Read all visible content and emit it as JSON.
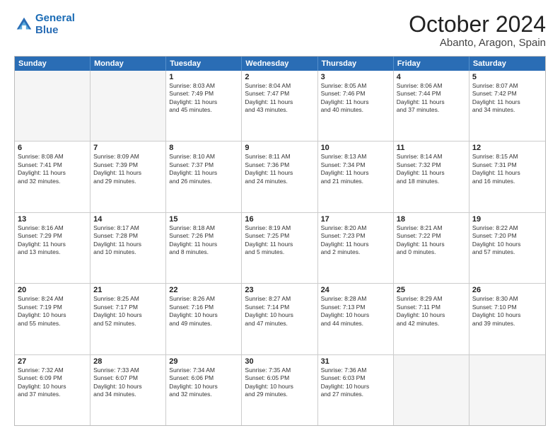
{
  "header": {
    "logo_line1": "General",
    "logo_line2": "Blue",
    "month": "October 2024",
    "location": "Abanto, Aragon, Spain"
  },
  "weekdays": [
    "Sunday",
    "Monday",
    "Tuesday",
    "Wednesday",
    "Thursday",
    "Friday",
    "Saturday"
  ],
  "rows": [
    [
      {
        "day": "",
        "text": ""
      },
      {
        "day": "",
        "text": ""
      },
      {
        "day": "1",
        "text": "Sunrise: 8:03 AM\nSunset: 7:49 PM\nDaylight: 11 hours\nand 45 minutes."
      },
      {
        "day": "2",
        "text": "Sunrise: 8:04 AM\nSunset: 7:47 PM\nDaylight: 11 hours\nand 43 minutes."
      },
      {
        "day": "3",
        "text": "Sunrise: 8:05 AM\nSunset: 7:46 PM\nDaylight: 11 hours\nand 40 minutes."
      },
      {
        "day": "4",
        "text": "Sunrise: 8:06 AM\nSunset: 7:44 PM\nDaylight: 11 hours\nand 37 minutes."
      },
      {
        "day": "5",
        "text": "Sunrise: 8:07 AM\nSunset: 7:42 PM\nDaylight: 11 hours\nand 34 minutes."
      }
    ],
    [
      {
        "day": "6",
        "text": "Sunrise: 8:08 AM\nSunset: 7:41 PM\nDaylight: 11 hours\nand 32 minutes."
      },
      {
        "day": "7",
        "text": "Sunrise: 8:09 AM\nSunset: 7:39 PM\nDaylight: 11 hours\nand 29 minutes."
      },
      {
        "day": "8",
        "text": "Sunrise: 8:10 AM\nSunset: 7:37 PM\nDaylight: 11 hours\nand 26 minutes."
      },
      {
        "day": "9",
        "text": "Sunrise: 8:11 AM\nSunset: 7:36 PM\nDaylight: 11 hours\nand 24 minutes."
      },
      {
        "day": "10",
        "text": "Sunrise: 8:13 AM\nSunset: 7:34 PM\nDaylight: 11 hours\nand 21 minutes."
      },
      {
        "day": "11",
        "text": "Sunrise: 8:14 AM\nSunset: 7:32 PM\nDaylight: 11 hours\nand 18 minutes."
      },
      {
        "day": "12",
        "text": "Sunrise: 8:15 AM\nSunset: 7:31 PM\nDaylight: 11 hours\nand 16 minutes."
      }
    ],
    [
      {
        "day": "13",
        "text": "Sunrise: 8:16 AM\nSunset: 7:29 PM\nDaylight: 11 hours\nand 13 minutes."
      },
      {
        "day": "14",
        "text": "Sunrise: 8:17 AM\nSunset: 7:28 PM\nDaylight: 11 hours\nand 10 minutes."
      },
      {
        "day": "15",
        "text": "Sunrise: 8:18 AM\nSunset: 7:26 PM\nDaylight: 11 hours\nand 8 minutes."
      },
      {
        "day": "16",
        "text": "Sunrise: 8:19 AM\nSunset: 7:25 PM\nDaylight: 11 hours\nand 5 minutes."
      },
      {
        "day": "17",
        "text": "Sunrise: 8:20 AM\nSunset: 7:23 PM\nDaylight: 11 hours\nand 2 minutes."
      },
      {
        "day": "18",
        "text": "Sunrise: 8:21 AM\nSunset: 7:22 PM\nDaylight: 11 hours\nand 0 minutes."
      },
      {
        "day": "19",
        "text": "Sunrise: 8:22 AM\nSunset: 7:20 PM\nDaylight: 10 hours\nand 57 minutes."
      }
    ],
    [
      {
        "day": "20",
        "text": "Sunrise: 8:24 AM\nSunset: 7:19 PM\nDaylight: 10 hours\nand 55 minutes."
      },
      {
        "day": "21",
        "text": "Sunrise: 8:25 AM\nSunset: 7:17 PM\nDaylight: 10 hours\nand 52 minutes."
      },
      {
        "day": "22",
        "text": "Sunrise: 8:26 AM\nSunset: 7:16 PM\nDaylight: 10 hours\nand 49 minutes."
      },
      {
        "day": "23",
        "text": "Sunrise: 8:27 AM\nSunset: 7:14 PM\nDaylight: 10 hours\nand 47 minutes."
      },
      {
        "day": "24",
        "text": "Sunrise: 8:28 AM\nSunset: 7:13 PM\nDaylight: 10 hours\nand 44 minutes."
      },
      {
        "day": "25",
        "text": "Sunrise: 8:29 AM\nSunset: 7:11 PM\nDaylight: 10 hours\nand 42 minutes."
      },
      {
        "day": "26",
        "text": "Sunrise: 8:30 AM\nSunset: 7:10 PM\nDaylight: 10 hours\nand 39 minutes."
      }
    ],
    [
      {
        "day": "27",
        "text": "Sunrise: 7:32 AM\nSunset: 6:09 PM\nDaylight: 10 hours\nand 37 minutes."
      },
      {
        "day": "28",
        "text": "Sunrise: 7:33 AM\nSunset: 6:07 PM\nDaylight: 10 hours\nand 34 minutes."
      },
      {
        "day": "29",
        "text": "Sunrise: 7:34 AM\nSunset: 6:06 PM\nDaylight: 10 hours\nand 32 minutes."
      },
      {
        "day": "30",
        "text": "Sunrise: 7:35 AM\nSunset: 6:05 PM\nDaylight: 10 hours\nand 29 minutes."
      },
      {
        "day": "31",
        "text": "Sunrise: 7:36 AM\nSunset: 6:03 PM\nDaylight: 10 hours\nand 27 minutes."
      },
      {
        "day": "",
        "text": ""
      },
      {
        "day": "",
        "text": ""
      }
    ]
  ]
}
